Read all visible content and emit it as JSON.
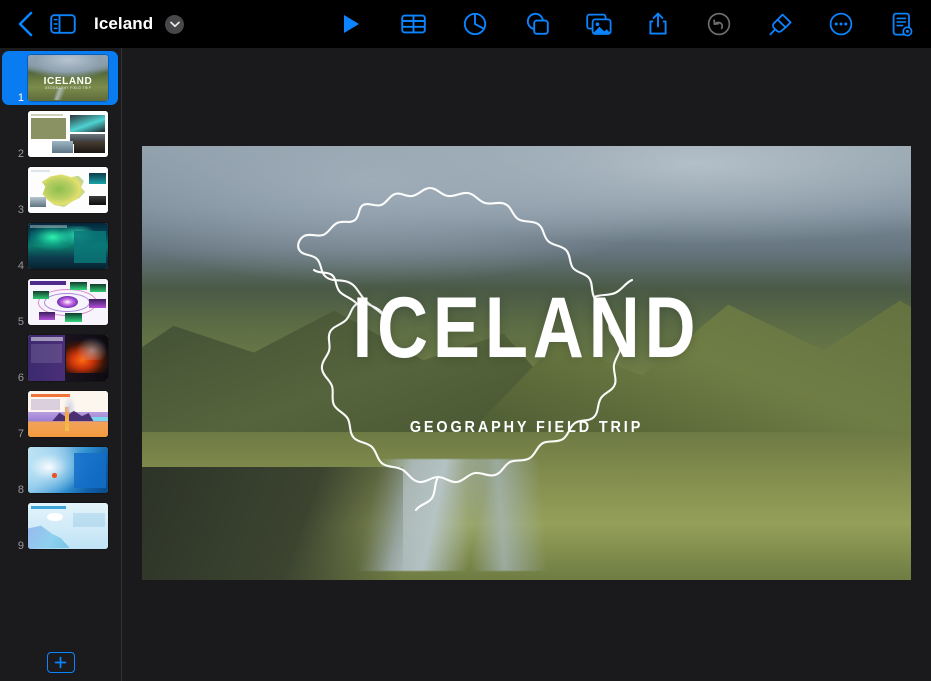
{
  "app": {
    "name": "Keynote",
    "accent_color": "#0a84ff",
    "toolbar_bg": "#000000",
    "canvas_bg": "#1a1a1c",
    "sidebar_bg": "#1b1b1d"
  },
  "toolbar": {
    "back_label": "Back",
    "sidebar_toggle_label": "Navigator",
    "document_title": "Iceland",
    "title_menu_label": "Document options",
    "center_tools": [
      {
        "name": "play-icon",
        "label": "Play"
      },
      {
        "name": "table-icon",
        "label": "Table"
      },
      {
        "name": "chart-icon",
        "label": "Chart"
      },
      {
        "name": "shape-icon",
        "label": "Shape"
      },
      {
        "name": "media-icon",
        "label": "Media"
      }
    ],
    "right_tools": [
      {
        "name": "share-icon",
        "label": "Share"
      },
      {
        "name": "undo-icon",
        "label": "Undo",
        "state": "disabled"
      },
      {
        "name": "format-brush-icon",
        "label": "Format"
      },
      {
        "name": "more-icon",
        "label": "More"
      },
      {
        "name": "document-options-icon",
        "label": "Document"
      }
    ]
  },
  "sidebar": {
    "add_slide_label": "Add Slide",
    "selected_slide": 1,
    "slides": [
      {
        "number": "1",
        "art": "s1",
        "title": "ICELAND",
        "subtitle": "GEOGRAPHY FIELD TRIP"
      },
      {
        "number": "2",
        "art": "s2",
        "title": "TRIP OBJECTIVES"
      },
      {
        "number": "3",
        "art": "s3",
        "title": "ICELAND"
      },
      {
        "number": "4",
        "art": "s4",
        "title": "DAY 1 · NORTHERN LIGHTS"
      },
      {
        "number": "5",
        "art": "s5",
        "title": "DAY 1 · AURORA FORECAST"
      },
      {
        "number": "6",
        "art": "s6",
        "title": "DAY 2 · VOLCANOES AND HOT SPRINGS"
      },
      {
        "number": "7",
        "art": "s7",
        "title": "DAY 2 · VOLCANOES AND HOT SPRINGS"
      },
      {
        "number": "8",
        "art": "s8",
        "title": "DAY 3 · GLACIERS AND ICE CAVES"
      },
      {
        "number": "9",
        "art": "s9",
        "title": "DAY 3 · GLACIERS AND ICE CAVES"
      }
    ]
  },
  "canvas": {
    "slide_title": "ICELAND",
    "slide_subtitle": "GEOGRAPHY FIELD TRIP",
    "map_shape_label": "Iceland outline",
    "background_label": "Iceland highlands photo"
  }
}
